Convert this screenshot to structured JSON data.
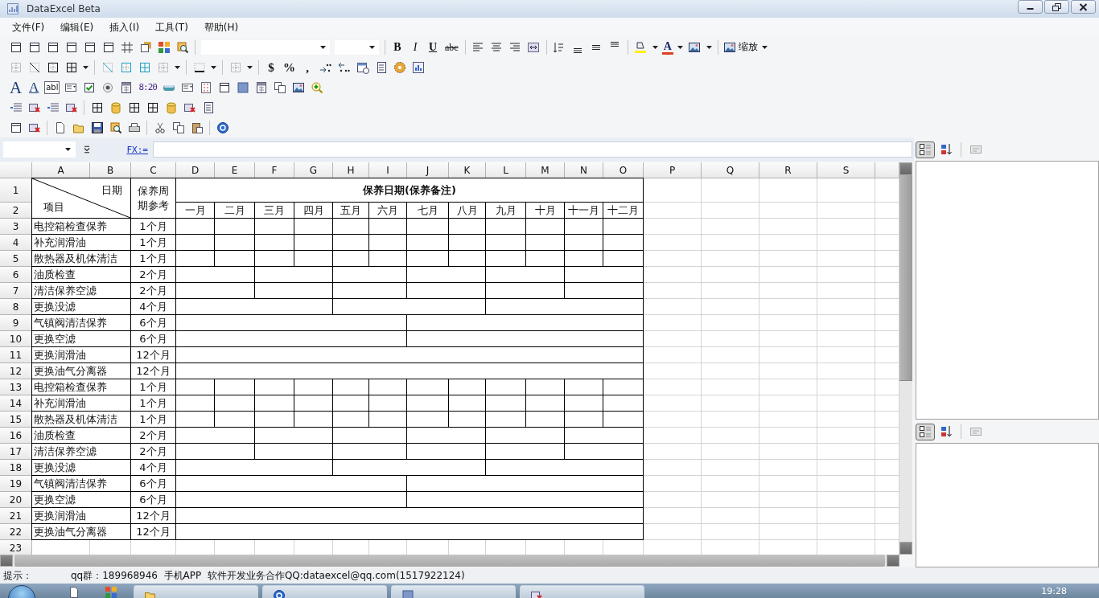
{
  "window": {
    "title": "DataExcel Beta"
  },
  "menu": [
    {
      "label": "文件(F)"
    },
    {
      "label": "编辑(E)"
    },
    {
      "label": "插入(I)"
    },
    {
      "label": "工具(T)"
    },
    {
      "label": "帮助(H)"
    }
  ],
  "toolbars": [
    [
      {
        "kind": "icon"
      },
      {
        "kind": "icon"
      },
      {
        "kind": "icon"
      },
      {
        "kind": "icon"
      },
      {
        "kind": "icon"
      },
      {
        "kind": "icon"
      },
      {
        "kind": "icon"
      },
      {
        "kind": "icon"
      },
      {
        "kind": "icon"
      },
      {
        "kind": "icon"
      },
      {
        "kind": "separator"
      },
      {
        "kind": "fontbox"
      },
      {
        "kind": "sizebox"
      },
      {
        "kind": "separator"
      },
      {
        "kind": "bold",
        "text": "B"
      },
      {
        "kind": "italic",
        "text": "I"
      },
      {
        "kind": "underline",
        "text": "U"
      },
      {
        "kind": "strike",
        "text": "abc"
      },
      {
        "kind": "separator"
      },
      {
        "kind": "icon"
      },
      {
        "kind": "icon"
      },
      {
        "kind": "icon"
      },
      {
        "kind": "icon"
      },
      {
        "kind": "separator"
      },
      {
        "kind": "icon"
      },
      {
        "kind": "icon"
      },
      {
        "kind": "icon"
      },
      {
        "kind": "icon"
      },
      {
        "kind": "separator"
      },
      {
        "kind": "icon"
      },
      {
        "kind": "caret"
      },
      {
        "kind": "fontcolor",
        "text": "A"
      },
      {
        "kind": "caret"
      },
      {
        "kind": "icon"
      },
      {
        "kind": "caret"
      },
      {
        "kind": "separator"
      },
      {
        "kind": "labeled",
        "text": "缩放"
      },
      {
        "kind": "caret"
      }
    ],
    [
      {
        "kind": "icon"
      },
      {
        "kind": "icon"
      },
      {
        "kind": "icon"
      },
      {
        "kind": "icon"
      },
      {
        "kind": "caret"
      },
      {
        "kind": "separator"
      },
      {
        "kind": "icon"
      },
      {
        "kind": "icon"
      },
      {
        "kind": "icon"
      },
      {
        "kind": "icon"
      },
      {
        "kind": "caret"
      },
      {
        "kind": "separator"
      },
      {
        "kind": "icon"
      },
      {
        "kind": "caret"
      },
      {
        "kind": "separator"
      },
      {
        "kind": "icon"
      },
      {
        "kind": "caret"
      },
      {
        "kind": "separator"
      },
      {
        "kind": "plain",
        "text": "$"
      },
      {
        "kind": "plain",
        "text": "%"
      },
      {
        "kind": "plain",
        "text": ","
      },
      {
        "kind": "icon"
      },
      {
        "kind": "icon"
      },
      {
        "kind": "icon"
      },
      {
        "kind": "icon"
      },
      {
        "kind": "icon"
      },
      {
        "kind": "icon"
      }
    ],
    [
      {
        "kind": "serif",
        "text": "A"
      },
      {
        "kind": "serifline",
        "text": "A"
      },
      {
        "kind": "boxed",
        "text": "abl"
      },
      {
        "kind": "icon"
      },
      {
        "kind": "icon"
      },
      {
        "kind": "icon"
      },
      {
        "kind": "icon"
      },
      {
        "kind": "digital",
        "text": "8:20"
      },
      {
        "kind": "icon"
      },
      {
        "kind": "icon"
      },
      {
        "kind": "icon"
      },
      {
        "kind": "icon"
      },
      {
        "kind": "icon"
      },
      {
        "kind": "icon"
      },
      {
        "kind": "icon"
      },
      {
        "kind": "icon"
      },
      {
        "kind": "icon"
      }
    ],
    [
      {
        "kind": "icon"
      },
      {
        "kind": "icon"
      },
      {
        "kind": "icon"
      },
      {
        "kind": "icon"
      },
      {
        "kind": "separator"
      },
      {
        "kind": "icon"
      },
      {
        "kind": "icon"
      },
      {
        "kind": "icon"
      },
      {
        "kind": "icon"
      },
      {
        "kind": "icon"
      },
      {
        "kind": "icon"
      },
      {
        "kind": "icon"
      }
    ],
    [
      {
        "kind": "icon"
      },
      {
        "kind": "icon"
      },
      {
        "kind": "separator"
      },
      {
        "kind": "icon"
      },
      {
        "kind": "icon"
      },
      {
        "kind": "icon"
      },
      {
        "kind": "icon"
      },
      {
        "kind": "icon"
      },
      {
        "kind": "separator"
      },
      {
        "kind": "icon"
      },
      {
        "kind": "icon"
      },
      {
        "kind": "icon"
      },
      {
        "kind": "separator"
      },
      {
        "kind": "icon"
      }
    ]
  ],
  "formula_bar": {
    "fx_label": "FX:="
  },
  "sheet": {
    "columns": [
      "A",
      "B",
      "C",
      "D",
      "E",
      "F",
      "G",
      "H",
      "I",
      "J",
      "K",
      "L",
      "M",
      "N",
      "O",
      "P",
      "Q",
      "R",
      "S"
    ],
    "row_numbers": [
      "1",
      "2",
      "3",
      "4",
      "5",
      "6",
      "7",
      "8",
      "9",
      "10",
      "11",
      "12",
      "13",
      "14",
      "15",
      "16",
      "17",
      "18",
      "19",
      "20",
      "21",
      "22",
      "23"
    ],
    "corner": {
      "column_caption": "日期",
      "row_caption": "项目"
    },
    "period_header": "保养周期参考",
    "title": "保养日期(保养备注)",
    "months": [
      "一月",
      "二月",
      "三月",
      "四月",
      "五月",
      "六月",
      "七月",
      "八月",
      "九月",
      "十月",
      "十一月",
      "十二月"
    ],
    "rows": [
      {
        "item": "电控箱检查保养",
        "period": "1个月",
        "kind": "one"
      },
      {
        "item": "补充润滑油",
        "period": "1个月",
        "kind": "one"
      },
      {
        "item": "散热器及机体清洁",
        "period": "1个月",
        "kind": "one"
      },
      {
        "item": "油质检查",
        "period": "2个月",
        "kind": "two"
      },
      {
        "item": "清洁保养空滤",
        "period": "2个月",
        "kind": "two"
      },
      {
        "item": "更换没滤",
        "period": "4个月",
        "kind": "four"
      },
      {
        "item": "气镇阀清洁保养",
        "period": "6个月",
        "kind": "six"
      },
      {
        "item": "更换空滤",
        "period": "6个月",
        "kind": "six"
      },
      {
        "item": "更换润滑油",
        "period": "12个月",
        "kind": "twelve"
      },
      {
        "item": "更换油气分离器",
        "period": "12个月",
        "kind": "twelve"
      },
      {
        "item": "电控箱检查保养",
        "period": "1个月",
        "kind": "one"
      },
      {
        "item": "补充润滑油",
        "period": "1个月",
        "kind": "one"
      },
      {
        "item": "散热器及机体清洁",
        "period": "1个月",
        "kind": "one"
      },
      {
        "item": "油质检查",
        "period": "2个月",
        "kind": "two"
      },
      {
        "item": "清洁保养空滤",
        "period": "2个月",
        "kind": "two"
      },
      {
        "item": "更换没滤",
        "period": "4个月",
        "kind": "four"
      },
      {
        "item": "气镇阀清洁保养",
        "period": "6个月",
        "kind": "six"
      },
      {
        "item": "更换空滤",
        "period": "6个月",
        "kind": "six"
      },
      {
        "item": "更换润滑油",
        "period": "12个月",
        "kind": "twelve"
      },
      {
        "item": "更换油气分离器",
        "period": "12个月",
        "kind": "twelve"
      }
    ]
  },
  "property_panels": [
    {
      "categorized": true
    },
    {
      "categorized": true
    }
  ],
  "status_bar": {
    "label": "提示：",
    "message": "qq群：189968946  手机APP  软件开发业务合作QQ:dataexcel@qq.com(1517922124)"
  },
  "taskbar": {
    "clock": "19:28"
  }
}
